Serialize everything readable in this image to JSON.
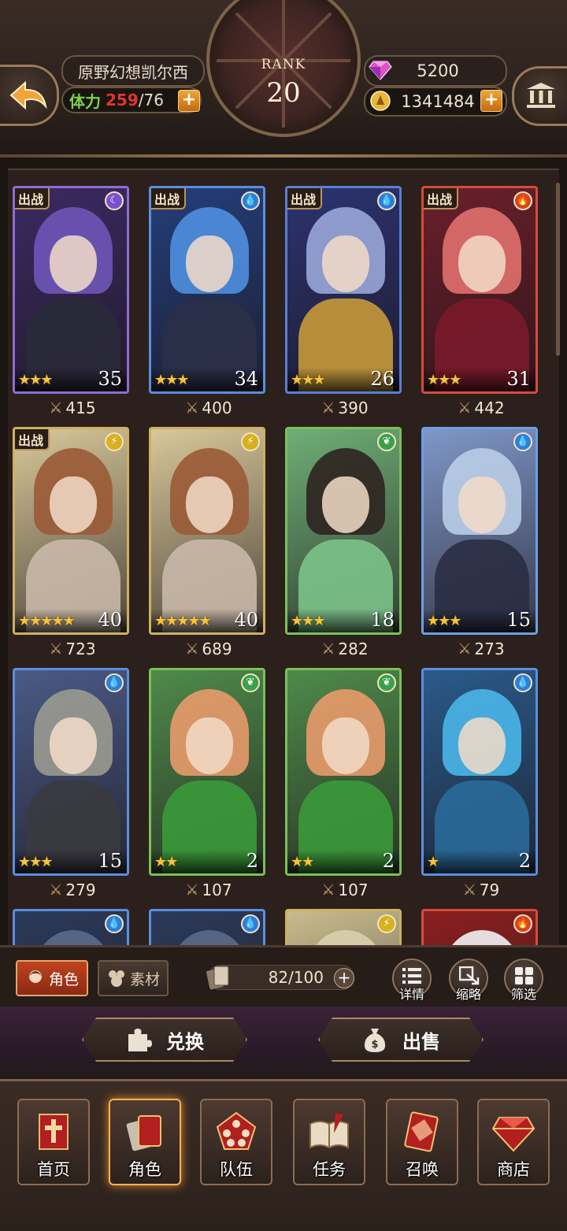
{
  "header": {
    "player_name": "原野幻想凯尔西",
    "stamina_label": "体力",
    "stamina_current": "259",
    "stamina_max": "/76",
    "rank_label": "RANK",
    "rank_value": "20",
    "gems": "5200",
    "gold": "1341484",
    "plus": "+"
  },
  "roster": {
    "deploy_tag": "出战",
    "cards": [
      {
        "deployed": true,
        "element": "dark",
        "stars": "★★★",
        "level": "35",
        "power": "415",
        "hair": "#6f55b8",
        "bg": "#3a2a62",
        "outfit": "#2a2a3a",
        "frame": "#8e6cd6"
      },
      {
        "deployed": true,
        "element": "water",
        "stars": "★★★",
        "level": "34",
        "power": "400",
        "hair": "#4f8fdf",
        "bg": "#243e7a",
        "outfit": "#2b3048",
        "frame": "#5a8fe0"
      },
      {
        "deployed": true,
        "element": "water",
        "stars": "★★★",
        "level": "26",
        "power": "390",
        "hair": "#9aa6d8",
        "bg": "#2b3370",
        "outfit": "#c79a3a",
        "frame": "#5a7ed6"
      },
      {
        "deployed": true,
        "element": "fire",
        "stars": "★★★",
        "level": "31",
        "power": "442",
        "hair": "#e0706d",
        "bg": "#6a1f2a",
        "outfit": "#7a1a2a",
        "frame": "#d64b3a"
      },
      {
        "deployed": true,
        "element": "light",
        "stars": "★★★★★",
        "level": "40",
        "power": "723",
        "hair": "#9a5a36",
        "bg": "#d8c89a",
        "outfit": "#c9b8a8",
        "frame": "#cdb062"
      },
      {
        "deployed": false,
        "element": "light",
        "stars": "★★★★★",
        "level": "40",
        "power": "689",
        "hair": "#9a5a36",
        "bg": "#d8c89a",
        "outfit": "#c9b8a8",
        "frame": "#cdb062"
      },
      {
        "deployed": false,
        "element": "wind",
        "stars": "★★★",
        "level": "18",
        "power": "282",
        "hair": "#2e2420",
        "bg": "#6fae76",
        "outfit": "#7cc28a",
        "frame": "#7cbf5a"
      },
      {
        "deployed": false,
        "element": "water",
        "stars": "★★★",
        "level": "15",
        "power": "273",
        "hair": "#b9cde8",
        "bg": "#7f97c8",
        "outfit": "#2a2e44",
        "frame": "#6aa0e6"
      },
      {
        "deployed": false,
        "element": "water",
        "stars": "★★★",
        "level": "15",
        "power": "279",
        "hair": "#9a9a90",
        "bg": "#4a5a86",
        "outfit": "#3a3a40",
        "frame": "#5a8fe0"
      },
      {
        "deployed": false,
        "element": "wind",
        "stars": "★★",
        "level": "2",
        "power": "107",
        "hair": "#e89a6c",
        "bg": "#4f8a4a",
        "outfit": "#3a9a3a",
        "frame": "#7cbf5a"
      },
      {
        "deployed": false,
        "element": "wind",
        "stars": "★★",
        "level": "2",
        "power": "107",
        "hair": "#e89a6c",
        "bg": "#4f8a4a",
        "outfit": "#3a9a3a",
        "frame": "#7cbf5a"
      },
      {
        "deployed": false,
        "element": "water",
        "stars": "★",
        "level": "2",
        "power": "79",
        "hair": "#4ab6e8",
        "bg": "#2a5a8a",
        "outfit": "#2a6a9a",
        "frame": "#5a8fe0"
      },
      {
        "deployed": false,
        "element": "water",
        "stars": "",
        "level": "",
        "power": "",
        "hair": "#5a6a88",
        "bg": "#2b3a5a",
        "outfit": "#3a3a44",
        "frame": "#5a8fe0"
      },
      {
        "deployed": false,
        "element": "water",
        "stars": "",
        "level": "",
        "power": "",
        "hair": "#5a6a88",
        "bg": "#2b3a5a",
        "outfit": "#3a3a44",
        "frame": "#5a8fe0"
      },
      {
        "deployed": false,
        "element": "light",
        "stars": "",
        "level": "",
        "power": "",
        "hair": "#d8cfae",
        "bg": "#c8bc8e",
        "outfit": "#b8a88a",
        "frame": "#cdb062"
      },
      {
        "deployed": false,
        "element": "fire",
        "stars": "",
        "level": "",
        "power": "",
        "hair": "#f2f2f2",
        "bg": "#8a1f1f",
        "outfit": "#a02222",
        "frame": "#d64b3a"
      }
    ]
  },
  "toolbar": {
    "tab_role": "角色",
    "tab_material": "素材",
    "capacity": "82/100",
    "detail": "详情",
    "strategy": "缩略",
    "filter": "筛选"
  },
  "actions": {
    "exchange": "兑换",
    "sell": "出售"
  },
  "nav": {
    "items": [
      "首页",
      "角色",
      "队伍",
      "任务",
      "召唤",
      "商店"
    ],
    "active_index": 1
  },
  "colors": {
    "dark": "#7b4fd0",
    "water": "#2f7ed8",
    "fire": "#d8441f",
    "light": "#d8b020",
    "wind": "#3aa04a"
  }
}
